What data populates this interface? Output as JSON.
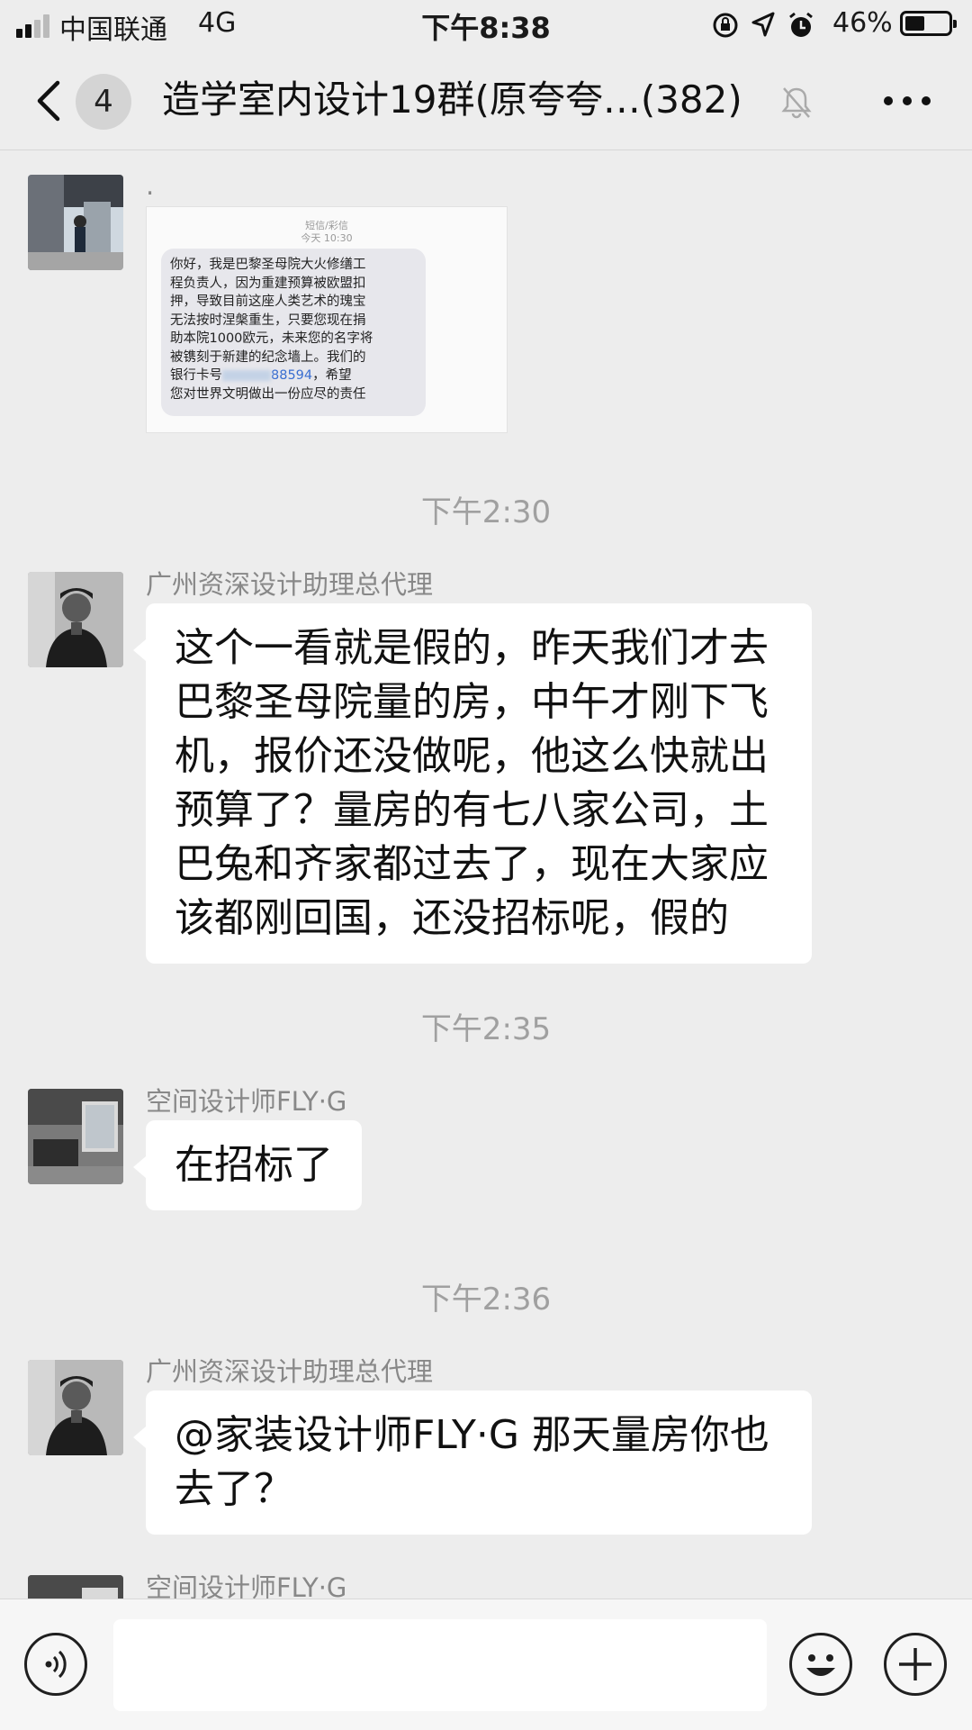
{
  "status_bar": {
    "carrier": "中国联通",
    "network": "4G",
    "time": "下午8:38",
    "battery_percent": "46%",
    "battery_level": 0.46,
    "signal_bars": 2
  },
  "nav": {
    "unread_count": "4",
    "title": "造学室内设计19群(原夸夸…(382)",
    "muted": true
  },
  "messages": [
    {
      "type": "image",
      "sender": ".",
      "image": {
        "header": "短信/彩信",
        "time": "今天 10:30",
        "lines": [
          "你好，我是巴黎圣母院大火修缮工",
          "程负责人，因为重建预算被欧盟扣",
          "押，导致目前这座人类艺术的瑰宝",
          "无法按时涅槃重生，只要您现在捐",
          "助本院1000欧元，未来您的名字将",
          "被镌刻于新建的纪念墙上。我们的"
        ],
        "bank_prefix": "银行卡号",
        "bank_number_partial": "88594",
        "bank_suffix": "，希望",
        "last_line": "您对世界文明做出一份应尽的责任"
      }
    },
    {
      "type": "time",
      "text": "下午2:30"
    },
    {
      "type": "text",
      "sender": "广州资深设计助理总代理",
      "lines": [
        "这个一看就是假的，昨天我们才去",
        "巴黎圣母院量的房，中午才刚下飞",
        "机，报价还没做呢，他这么快就出",
        "预算了？量房的有七八家公司，土",
        "巴兔和齐家都过去了，现在大家应",
        "该都刚回国，还没招标呢，假的"
      ]
    },
    {
      "type": "time",
      "text": "下午2:35"
    },
    {
      "type": "text",
      "sender": "空间设计师FLY·G",
      "lines": [
        "在招标了"
      ]
    },
    {
      "type": "time",
      "text": "下午2:36"
    },
    {
      "type": "text",
      "sender": "广州资深设计助理总代理",
      "lines": [
        "@家装设计师FLY·G 那天量房你也",
        "去了？"
      ]
    },
    {
      "type": "partial",
      "sender": "空间设计师FLY·G"
    }
  ],
  "input_bar": {
    "voice_icon": "voice-icon",
    "emoji_icon": "emoji-icon",
    "plus_icon": "plus-icon",
    "placeholder": ""
  }
}
